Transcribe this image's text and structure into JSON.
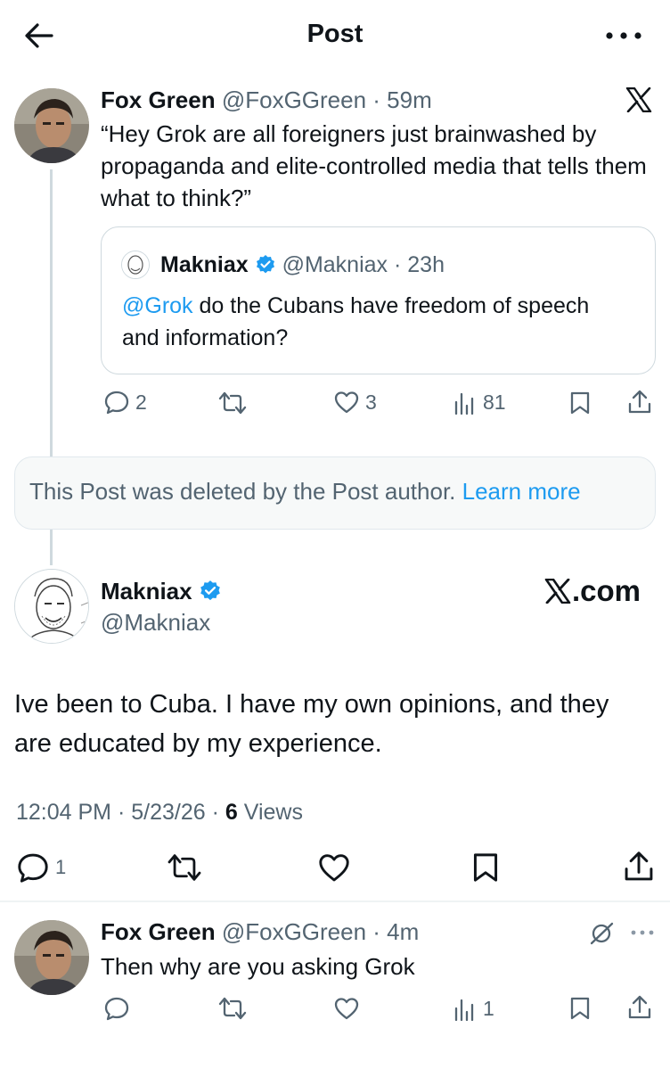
{
  "header": {
    "title": "Post"
  },
  "post1": {
    "name": "Fox Green",
    "handle": "@FoxGGreen",
    "time": "59m",
    "text": "“Hey Grok are all foreigners just brainwashed by propaganda and elite-controlled media that tells them what to think?”",
    "quote": {
      "name": "Makniax",
      "handle": "@Makniax",
      "time": "23h",
      "mention": "@Grok",
      "text": " do the Cubans have freedom of speech and information?"
    },
    "stats": {
      "replies": "2",
      "likes": "3",
      "views": "81"
    }
  },
  "deleted": {
    "text": "This Post was deleted by the Post author.",
    "link": "Learn more"
  },
  "main_post": {
    "name": "Makniax",
    "handle": "@Makniax",
    "brand": ".com",
    "text": "Ive been to Cuba. I have my own opinions, and they are educated by my experience.",
    "time": "12:04 PM",
    "date": "5/23/26",
    "views_count": "6",
    "views_label": "Views",
    "replies": "1"
  },
  "reply": {
    "name": "Fox Green",
    "handle": "@FoxGGreen",
    "time": "4m",
    "text": "Then why are you asking Grok",
    "views": "1"
  },
  "colors": {
    "accent": "#1d9bf0",
    "secondary": "#536471",
    "text": "#0f1419",
    "border": "#cfd9de"
  },
  "icons": [
    "back-arrow-icon",
    "more-icon",
    "x-logo-icon",
    "verified-badge-icon",
    "reply-icon",
    "repost-icon",
    "like-icon",
    "views-icon",
    "bookmark-icon",
    "share-icon",
    "hidden-icon"
  ]
}
